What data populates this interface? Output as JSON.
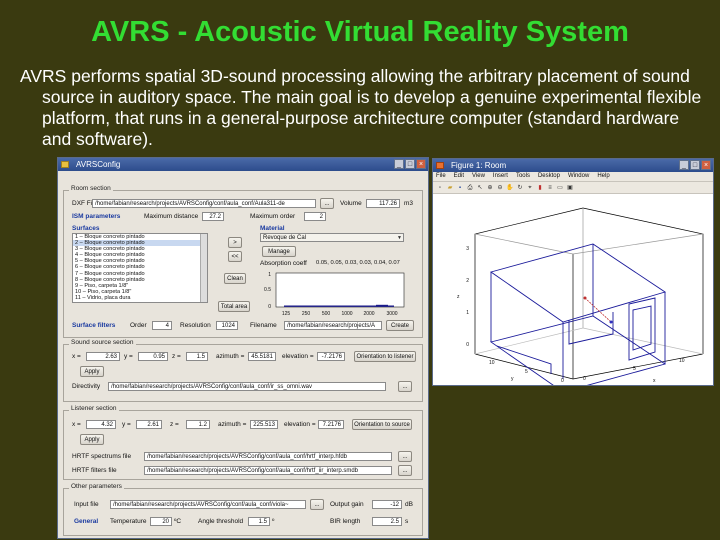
{
  "slide": {
    "title": "AVRS - Acoustic Virtual Reality System",
    "body": "AVRS performs spatial 3D-sound processing allowing the arbitrary placement of sound source in auditory space. The main goal is to develop a genuine experimental flexible platform, that runs in a general-purpose architecture computer (standard hardware and software)."
  },
  "config_window": {
    "title": "AVRSConfig",
    "room_section": {
      "label": "Room section",
      "dxf_label": "DXF File",
      "dxf_value": "/home/fabian/research/projects/AVRSConfig/conf/aula_conf/Aula311-de",
      "browse": "...",
      "volume_label": "Volume",
      "volume_value": "117.26",
      "volume_unit": "m3",
      "ism_label": "ISM parameters",
      "max_distance_label": "Maximum distance",
      "max_distance_value": "27.2",
      "max_order_label": "Maximum order",
      "max_order_value": "2",
      "surfaces_label": "Surfaces",
      "surfaces": [
        "1 – Bloque concreto pintado",
        "2 – Bloque concreto pintado",
        "3 – Bloque concreto pintado",
        "4 – Bloque concreto pintado",
        "5 – Bloque concreto pintado",
        "6 – Bloque concreto pintado",
        "7 – Bloque concreto pintado",
        "8 – Bloque concreto pintado",
        "9 – Piso, carpeta 1/8\"",
        "10 – Piso, carpeta 1/8\"",
        "11 – Vidrio, placa dura"
      ],
      "add_btn": ">",
      "addall_btn": "<<",
      "clean_btn": "Clean",
      "total_area_btn": "Total area",
      "material_label": "Material",
      "material_value": "Revoque de Cal",
      "manage_btn": "Manage",
      "absorption_label": "Absorption coeff",
      "absorption_values": "0.05, 0.05, 0.03, 0.03, 0.04, 0.07",
      "chart_yticks": [
        "1",
        "0.5",
        "0"
      ],
      "chart_xticks": [
        "125",
        "250",
        "500",
        "1000",
        "2000",
        "3000"
      ],
      "surface_filters_label": "Surface filters",
      "order_label": "Order",
      "order_value": "4",
      "resolution_label": "Resolution",
      "resolution_value": "1024",
      "filename_label": "Filename",
      "filename_value": "/home/fabian/research/projects/A",
      "create_btn": "Create"
    },
    "source_section": {
      "label": "Sound source section",
      "x_label": "x =",
      "x_value": "2.63",
      "y_label": "y =",
      "y_value": "0.95",
      "z_label": "z =",
      "z_value": "1.5",
      "azimuth_label": "azimuth =",
      "azimuth_value": "45.5181",
      "elevation_label": "elevation =",
      "elevation_value": "-7.2176",
      "orient_btn": "Orientation to listener",
      "apply_btn": "Apply",
      "directivity_label": "Directivity",
      "directivity_value": "/home/fabian/research/projects/AVRSConfig/conf/aula_conf/ir_ss_omni.wav",
      "browse": "..."
    },
    "listener_section": {
      "label": "Listener section",
      "x_label": "x =",
      "x_value": "4.32",
      "y_label": "y =",
      "y_value": "2.61",
      "z_label": "z =",
      "z_value": "1.2",
      "azimuth_label": "azimuth =",
      "azimuth_value": "225.513",
      "elevation_label": "elevation =",
      "elevation_value": "7.2176",
      "orient_btn": "Orientation to source",
      "apply_btn": "Apply",
      "hrtf_spectrums_label": "HRTF spectrums file",
      "hrtf_spectrums_value": "/home/fabian/research/projects/AVRSConfig/conf/aula_conf/hrtf_interp.hfdb",
      "hrtf_filters_label": "HRTF filters file",
      "hrtf_filters_value": "/home/fabian/research/projects/AVRSConfig/conf/aula_conf/hrtf_iir_interp.smdb",
      "browse": "..."
    },
    "other_section": {
      "label": "Other parameters",
      "input_file_label": "Input file",
      "input_file_value": "/home/fabian/research/projects/AVRSConfig/conf/aula_conf/viola~",
      "browse": "...",
      "output_gain_label": "Output gain",
      "output_gain_value": "-12",
      "output_gain_unit": "dB",
      "general_label": "General",
      "temperature_label": "Temperature",
      "temperature_value": "20",
      "temperature_unit": "ºC",
      "angle_threshold_label": "Angle threshold",
      "angle_threshold_value": "1.5",
      "angle_threshold_unit": "º",
      "bir_length_label": "BIR length",
      "bir_length_value": "2.5",
      "bir_length_unit": "s"
    }
  },
  "figure_window": {
    "title": "Figure 1: Room",
    "menu": [
      "File",
      "Edit",
      "View",
      "Insert",
      "Tools",
      "Desktop",
      "Window",
      "Help"
    ],
    "z_ticks": [
      "3",
      "2",
      "1",
      "0"
    ],
    "y_ticks": [
      "10",
      "5",
      "0"
    ],
    "x_ticks": [
      "0",
      "5",
      "10"
    ],
    "z_axis_label": "z",
    "y_axis_label": "y",
    "x_axis_label": "x"
  },
  "colors": {
    "background": "#3a3a10",
    "title": "#33dd33",
    "body_text": "#ffffff",
    "accent_blue": "#1a3aa0"
  }
}
